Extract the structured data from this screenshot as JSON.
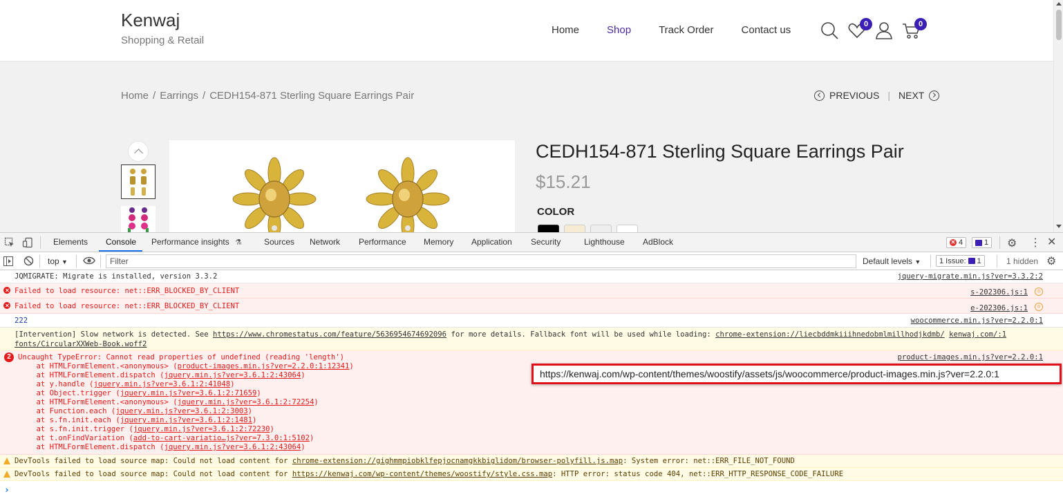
{
  "site": {
    "title": "Kenwaj",
    "tagline": "Shopping & Retail",
    "nav": [
      "Home",
      "Shop",
      "Track Order",
      "Contact us"
    ],
    "wishlist_count": "0",
    "cart_count": "0",
    "accent_color": "#3c1fb5"
  },
  "breadcrumb": {
    "items": [
      "Home",
      "Earrings",
      "CEDH154-871 Sterling Square Earrings Pair"
    ],
    "separator": "/"
  },
  "pager": {
    "previous": "PREVIOUS",
    "next": "NEXT"
  },
  "product": {
    "title": "CEDH154-871 Sterling Square Earrings Pair",
    "price": "$15.21",
    "color_label": "COLOR",
    "swatches": [
      "#000000",
      "#f6ecd3",
      "#eeeeee",
      "#ffffff"
    ]
  },
  "devtools": {
    "tabs": [
      "Elements",
      "Console",
      "Performance insights",
      "Sources",
      "Network",
      "Performance",
      "Memory",
      "Application",
      "Security",
      "Lighthouse",
      "AdBlock"
    ],
    "active_tab": "Console",
    "error_count": "4",
    "issue_count_top": "1",
    "context": "top",
    "filter_placeholder": "Filter",
    "levels": "Default levels",
    "issues_label": "1 Issue:",
    "issues_count": "1",
    "hidden_label": "1 hidden"
  },
  "console": {
    "jqmigrate": {
      "text": "JQMIGRATE: Migrate is installed, version 3.3.2",
      "source": "jquery-migrate.min.js?ver=3.3.2:2"
    },
    "blocked1": {
      "text": "Failed to load resource: net::ERR_BLOCKED_BY_CLIENT",
      "source": "s-202306.js:1"
    },
    "blocked2": {
      "text": "Failed to load resource: net::ERR_BLOCKED_BY_CLIENT",
      "source": "e-202306.js:1"
    },
    "log222": {
      "text": "222",
      "source": "woocommerce.min.js?ver=2.2.0:1"
    },
    "intervention": {
      "prefix": "[Intervention] Slow network is detected. See ",
      "link1": "https://www.chromestatus.com/feature/5636954674692096",
      "middle": " for more details. Fallback font will be used while loading: ",
      "link2": "chrome-extension://liecbddmkiiihnedobmlmillhodjkdmb/",
      "link3": "kenwaj.com/:1",
      "line2": "fonts/CircularXXWeb-Book.woff2"
    },
    "typeerror": {
      "count": "2",
      "text": "Uncaught TypeError: Cannot read properties of undefined (reading 'length')",
      "source": "product-images.min.js?ver=2.2.0:1",
      "stack": [
        {
          "fn": "at HTMLFormElement.<anonymous> (",
          "link": "product-images.min.js?ver=2.2.0:1:12341"
        },
        {
          "fn": "at HTMLFormElement.dispatch (",
          "link": "jquery.min.js?ver=3.6.1:2:43064"
        },
        {
          "fn": "at y.handle (",
          "link": "jquery.min.js?ver=3.6.1:2:41048"
        },
        {
          "fn": "at Object.trigger (",
          "link": "jquery.min.js?ver=3.6.1:2:71659"
        },
        {
          "fn": "at HTMLFormElement.<anonymous> (",
          "link": "jquery.min.js?ver=3.6.1:2:72254"
        },
        {
          "fn": "at Function.each (",
          "link": "jquery.min.js?ver=3.6.1:2:3003"
        },
        {
          "fn": "at s.fn.init.each (",
          "link": "jquery.min.js?ver=3.6.1:2:1481"
        },
        {
          "fn": "at s.fn.init.trigger (",
          "link": "jquery.min.js?ver=3.6.1:2:72230"
        },
        {
          "fn": "at t.onFindVariation (",
          "link": "add-to-cart-variatio…js?ver=7.3.0:1:5102"
        },
        {
          "fn": "at HTMLFormElement.dispatch (",
          "link": "jquery.min.js?ver=3.6.1:2:43064"
        }
      ]
    },
    "warn1": {
      "prefix": "DevTools failed to load source map: Could not load content for ",
      "link": "chrome-extension://gighmmpiobklfepjocnamgkkbiglidom/browser-polyfill.js.map",
      "suffix": ": System error: net::ERR_FILE_NOT_FOUND"
    },
    "warn2": {
      "prefix": "DevTools failed to load source map: Could not load content for ",
      "link": "https://kenwaj.com/wp-content/themes/woostify/style.css.map",
      "suffix": ": HTTP error: status code 404, net::ERR_HTTP_RESPONSE_CODE_FAILURE"
    },
    "prompt": "›"
  },
  "tooltip": {
    "url": "https://kenwaj.com/wp-content/themes/woostify/assets/js/woocommerce/product-images.min.js?ver=2.2.0:1"
  }
}
